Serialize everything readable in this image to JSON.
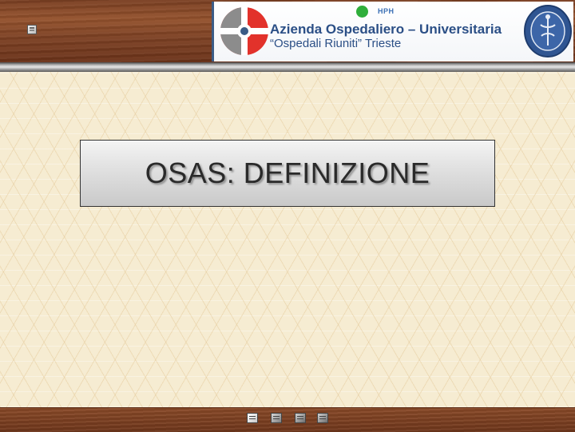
{
  "header": {
    "banner": {
      "hph_label": "HPH",
      "org_name_line1": "Azienda Ospedaliero – Universitaria",
      "org_name_line2": "“Ospedali Riuniti” Trieste",
      "logo_icon": "hospital-logo-icon",
      "seal_icon": "university-seal-icon"
    },
    "menu_icon": "slide-menu-icon"
  },
  "slide": {
    "title": "OSAS: DEFINIZIONE"
  },
  "footer": {
    "nav_icons": [
      "slide-nav-icon",
      "slide-nav-icon",
      "slide-nav-icon",
      "slide-nav-icon"
    ]
  },
  "colors": {
    "wood": "#7c4023",
    "background": "#f6ecd2",
    "org_text": "#2b4f86",
    "hph_green": "#2fae3b",
    "logo_red": "#e2322b"
  }
}
